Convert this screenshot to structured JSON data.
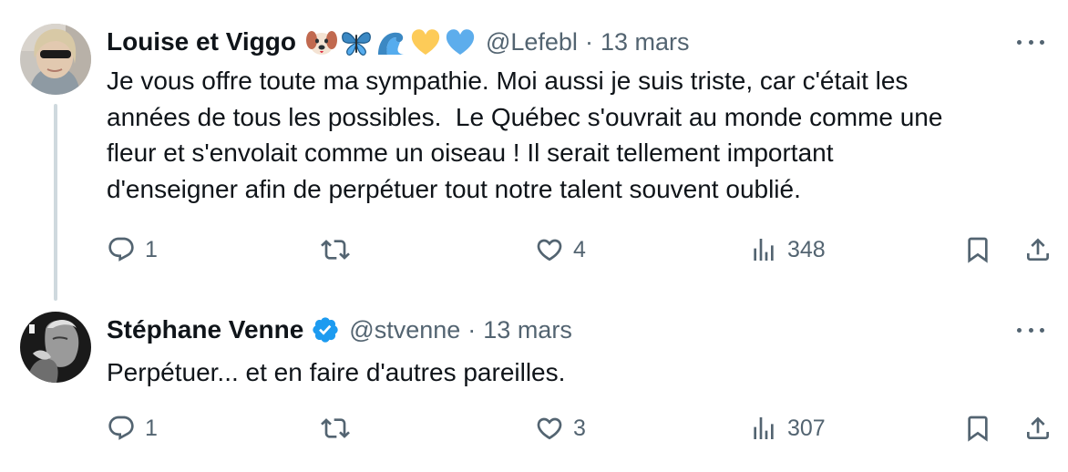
{
  "tweets": [
    {
      "author_name": "Louise et Viggo",
      "emojis": [
        "dog-face-emoji",
        "butterfly-emoji",
        "wave-emoji",
        "yellow-heart-emoji",
        "blue-heart-emoji"
      ],
      "handle": "@Lefebl",
      "separator": "·",
      "date": "13 mars",
      "text": "Je vous offre toute ma sympathie. Moi aussi je suis triste, car c'était les\nannées de tous les possibles.  Le Québec s'ouvrait au monde comme une\nfleur et s'envolait comme un oiseau ! Il serait tellement important\nd'enseigner afin de perpétuer tout notre talent souvent oublié.",
      "replies": "1",
      "reposts": "",
      "likes": "4",
      "views": "348"
    },
    {
      "author_name": "Stéphane Venne",
      "verified": true,
      "handle": "@stvenne",
      "separator": "·",
      "date": "13 mars",
      "text": "Perpétuer... et en faire d'autres pareilles.",
      "replies": "1",
      "reposts": "",
      "likes": "3",
      "views": "307"
    }
  ],
  "colors": {
    "text": "#0f1419",
    "secondary": "#536471",
    "verified_blue": "#1d9bf0",
    "thread_line": "#cfd9de"
  }
}
